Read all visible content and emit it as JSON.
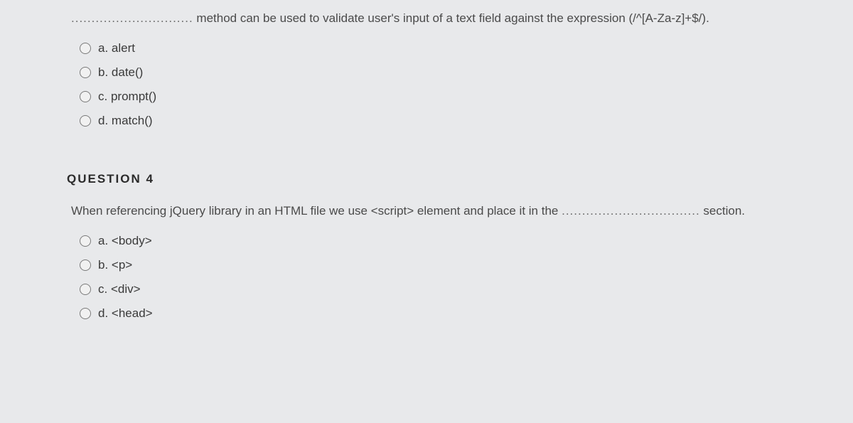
{
  "q3": {
    "blank_dots": "..............................",
    "prompt_tail": " method can be used to validate user's input of a text field against the expression (/^[A-Za-z]+$/).",
    "options": [
      {
        "letter": "a.",
        "text": "alert"
      },
      {
        "letter": "b.",
        "text": "date()"
      },
      {
        "letter": "c.",
        "text": "prompt()"
      },
      {
        "letter": "d.",
        "text": "match()"
      }
    ]
  },
  "q4": {
    "heading": "QUESTION 4",
    "prompt_head": "When referencing jQuery library in an HTML file we use <script> element and place it in the ",
    "blank_dots": "..................................",
    "prompt_tail": " section.",
    "options": [
      {
        "letter": "a.",
        "text": "<body>"
      },
      {
        "letter": "b.",
        "text": "<p>"
      },
      {
        "letter": "c.",
        "text": "<div>"
      },
      {
        "letter": "d.",
        "text": "<head>"
      }
    ]
  }
}
